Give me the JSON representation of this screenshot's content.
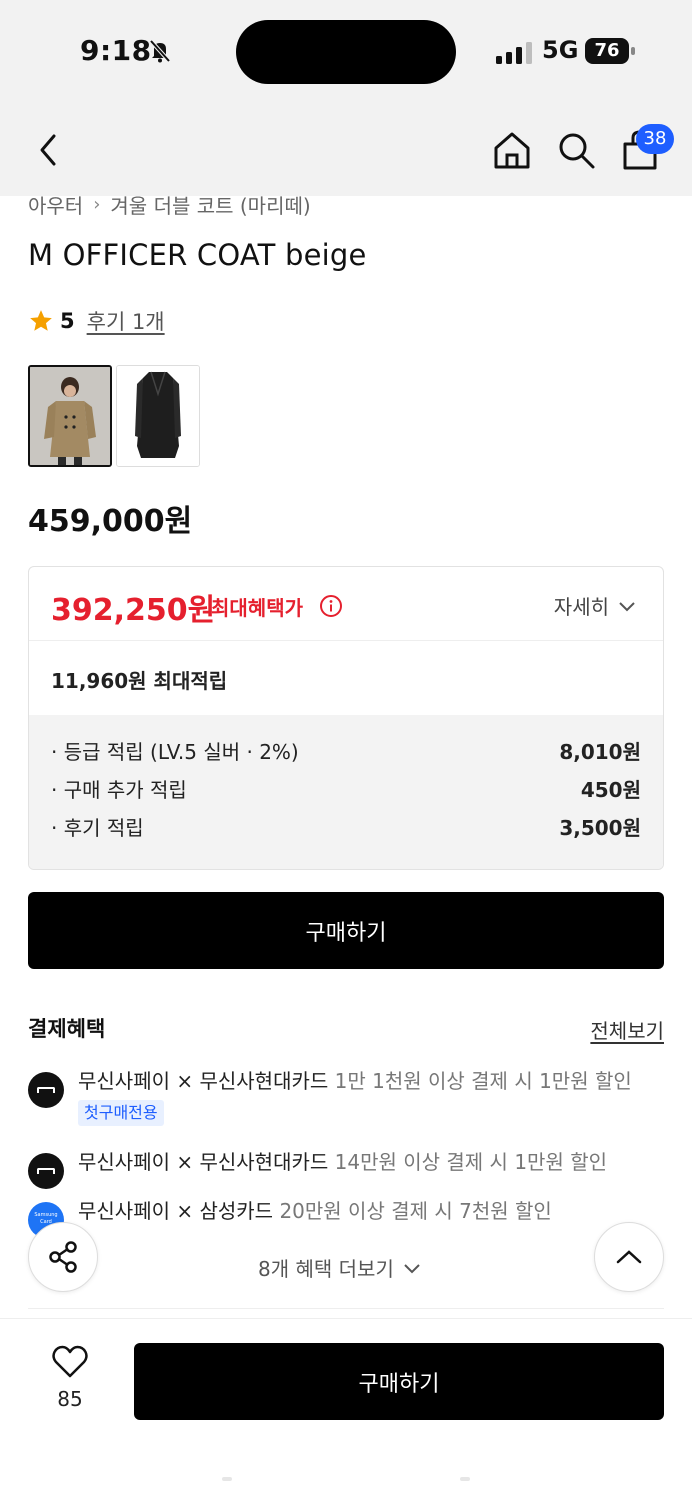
{
  "status_bar": {
    "time": "9:18",
    "network": "5G",
    "battery": "76"
  },
  "header": {
    "cart_count": "38"
  },
  "breadcrumb": {
    "category": "아우터",
    "subcategory": "겨울 더블 코트 (마리떼)"
  },
  "product": {
    "title": "M OFFICER COAT beige",
    "rating": "5",
    "review_link": "후기 1개",
    "price": "459,000원"
  },
  "benefit": {
    "max_price": "392,250원",
    "max_label": "최대혜택가",
    "detail_toggle": "자세히",
    "max_points": "11,960원 최대적립",
    "points": [
      {
        "label": "· 등급 적립 (LV.5 실버 · 2%)",
        "amount": "8,010원"
      },
      {
        "label": "· 구매 추가 적립",
        "amount": "450원"
      },
      {
        "label": "· 후기 적립",
        "amount": "3,500원"
      }
    ]
  },
  "buy_button_label": "구매하기",
  "payment": {
    "title": "결제혜택",
    "view_all": "전체보기",
    "items": [
      {
        "name": "무신사페이 × 무신사현대카드",
        "desc": "1만 1천원 이상 결제 시 1만원 할인",
        "tag": "첫구매전용",
        "logo": "musinsa-logo"
      },
      {
        "name": "무신사페이 × 무신사현대카드",
        "desc": "14만원 이상 결제 시 1만원 할인",
        "logo": "musinsa-logo"
      },
      {
        "name": "무신사페이 × 삼성카드",
        "desc": "20만원 이상 결제 시 7천원 할인",
        "logo": "samsung-card-logo",
        "logo_text": "Samsung Card"
      }
    ],
    "more": "8개 혜택 더보기"
  },
  "bottom_bar": {
    "like_count": "85",
    "buy_label": "구매하기"
  },
  "colors": {
    "accent_red": "#e5202e",
    "badge_blue": "#1e5eff",
    "button_black": "#000000"
  }
}
